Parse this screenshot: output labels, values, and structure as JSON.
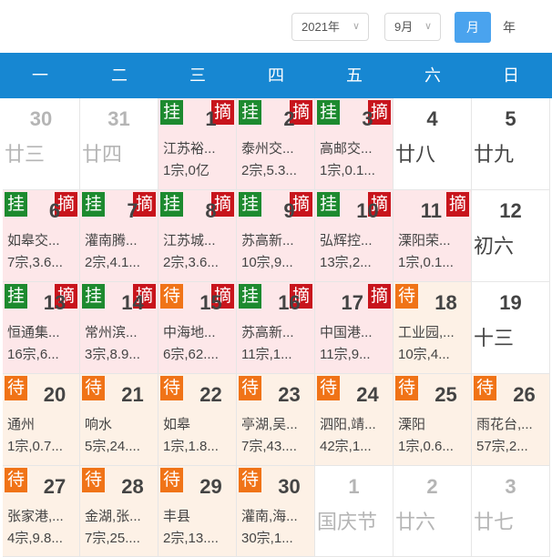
{
  "toolbar": {
    "year_value": "2021年",
    "month_value": "9月",
    "month_button": "月",
    "year_button": "年"
  },
  "weekdays": [
    "一",
    "二",
    "三",
    "四",
    "五",
    "六",
    "日"
  ],
  "tags": {
    "listed": "挂",
    "delisted": "摘",
    "pending": "待"
  },
  "weeks": [
    [
      {
        "day": "30",
        "lunar": "廿三",
        "other_month": true
      },
      {
        "day": "31",
        "lunar": "廿四",
        "other_month": true
      },
      {
        "day": "1",
        "listed": true,
        "delisted": true,
        "region": "江苏裕...",
        "summary": "1宗,0亿"
      },
      {
        "day": "2",
        "listed": true,
        "delisted": true,
        "region": "泰州交...",
        "summary": "2宗,5.3..."
      },
      {
        "day": "3",
        "listed": true,
        "delisted": true,
        "region": "高邮交...",
        "summary": "1宗,0.1..."
      },
      {
        "day": "4",
        "lunar": "廿八"
      },
      {
        "day": "5",
        "lunar": "廿九"
      }
    ],
    [
      {
        "day": "6",
        "listed": true,
        "delisted": true,
        "region": "如皋交...",
        "summary": "7宗,3.6..."
      },
      {
        "day": "7",
        "listed": true,
        "delisted": true,
        "region": "灌南腾...",
        "summary": "2宗,4.1..."
      },
      {
        "day": "8",
        "listed": true,
        "delisted": true,
        "region": "江苏城...",
        "summary": "2宗,3.6..."
      },
      {
        "day": "9",
        "listed": true,
        "delisted": true,
        "region": "苏高新...",
        "summary": "10宗,9..."
      },
      {
        "day": "10",
        "listed": true,
        "delisted": true,
        "region": "弘辉控...",
        "summary": "13宗,2..."
      },
      {
        "day": "11",
        "delisted": true,
        "region": "溧阳荣...",
        "summary": "1宗,0.1..."
      },
      {
        "day": "12",
        "lunar": "初六"
      }
    ],
    [
      {
        "day": "13",
        "listed": true,
        "delisted": true,
        "region": "恒通集...",
        "summary": "16宗,6..."
      },
      {
        "day": "14",
        "listed": true,
        "delisted": true,
        "region": "常州滨...",
        "summary": "3宗,8.9..."
      },
      {
        "day": "15",
        "pending": true,
        "delisted": true,
        "region": "中海地...",
        "summary": "6宗,62...."
      },
      {
        "day": "16",
        "listed": true,
        "delisted": true,
        "region": "苏高新...",
        "summary": "11宗,1..."
      },
      {
        "day": "17",
        "delisted": true,
        "region": "中国港...",
        "summary": "11宗,9..."
      },
      {
        "day": "18",
        "pending": true,
        "region": "工业园,...",
        "summary": "10宗,4..."
      },
      {
        "day": "19",
        "lunar": "十三"
      }
    ],
    [
      {
        "day": "20",
        "pending": true,
        "region": "通州",
        "summary": "1宗,0.7..."
      },
      {
        "day": "21",
        "pending": true,
        "region": "响水",
        "summary": "5宗,24...."
      },
      {
        "day": "22",
        "pending": true,
        "region": "如皋",
        "summary": "1宗,1.8..."
      },
      {
        "day": "23",
        "pending": true,
        "region": "亭湖,吴...",
        "summary": "7宗,43...."
      },
      {
        "day": "24",
        "pending": true,
        "region": "泗阳,靖...",
        "summary": "42宗,1..."
      },
      {
        "day": "25",
        "pending": true,
        "region": "溧阳",
        "summary": "1宗,0.6..."
      },
      {
        "day": "26",
        "pending": true,
        "region": "雨花台,...",
        "summary": "57宗,2..."
      }
    ],
    [
      {
        "day": "27",
        "pending": true,
        "region": "张家港,...",
        "summary": "4宗,9.8..."
      },
      {
        "day": "28",
        "pending": true,
        "region": "金湖,张...",
        "summary": "7宗,25...."
      },
      {
        "day": "29",
        "pending": true,
        "region": "丰县",
        "summary": "2宗,13...."
      },
      {
        "day": "30",
        "pending": true,
        "region": "灌南,海...",
        "summary": "30宗,1..."
      },
      {
        "day": "1",
        "lunar": "国庆节",
        "other_month": true
      },
      {
        "day": "2",
        "lunar": "廿六",
        "other_month": true
      },
      {
        "day": "3",
        "lunar": "廿七",
        "other_month": true
      }
    ]
  ],
  "colors": {
    "header_blue": "#1787d2",
    "listed_green": "#1d8a2f",
    "delisted_red": "#c8141c",
    "pending_orange": "#f07317",
    "active_cell_pink": "#fde7e9",
    "pending_cell_peach": "#fdf1e6"
  }
}
